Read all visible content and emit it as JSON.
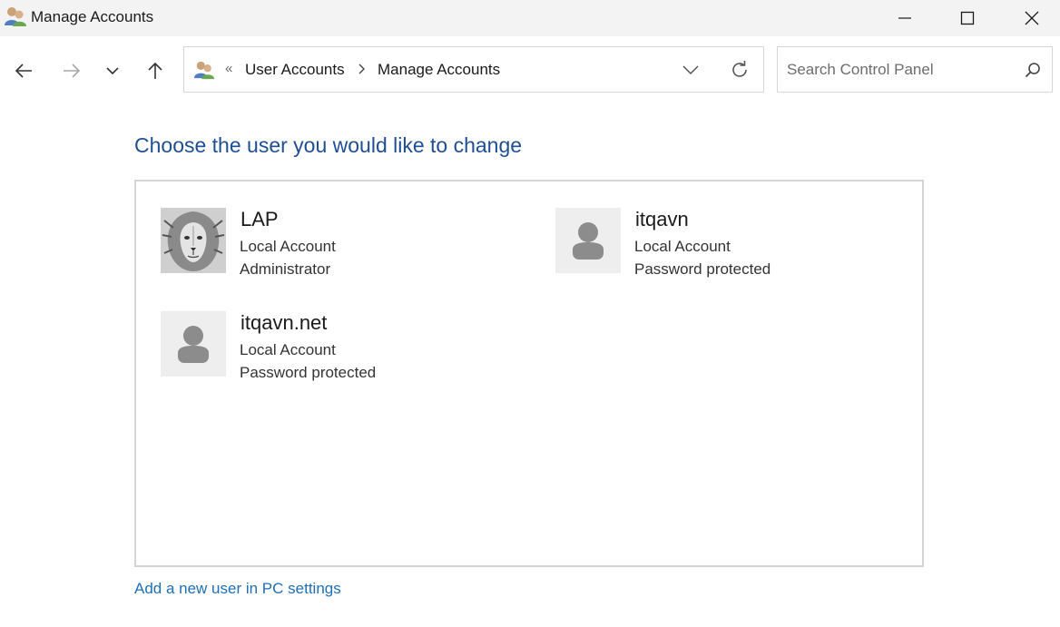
{
  "window": {
    "title": "Manage Accounts",
    "app_icon": "user-accounts-icon",
    "controls": [
      "minimize-icon",
      "maximize-icon",
      "close-icon"
    ]
  },
  "navigation": {
    "back": "back-arrow-icon",
    "forward": "forward-arrow-icon",
    "recent": "chevron-down-icon",
    "up": "up-arrow-icon"
  },
  "address_bar": {
    "location_icon": "user-accounts-icon",
    "overflow": "«",
    "breadcrumbs": [
      "User Accounts",
      "Manage Accounts"
    ],
    "dropdown": "chevron-down-icon",
    "refresh": "refresh-icon"
  },
  "search": {
    "placeholder": "Search Control Panel",
    "icon": "search-icon"
  },
  "main": {
    "heading": "Choose the user you would like to change",
    "users": [
      {
        "name": "LAP",
        "account_type": "Local Account",
        "detail": "Administrator",
        "picture": "lion-avatar"
      },
      {
        "name": "itqavn",
        "account_type": "Local Account",
        "detail": "Password protected",
        "picture": "default-user-icon"
      },
      {
        "name": "itqavn.net",
        "account_type": "Local Account",
        "detail": "Password protected",
        "picture": "default-user-icon"
      }
    ],
    "add_user_link": "Add a new user in PC settings"
  },
  "colors": {
    "heading": "#1e4f93",
    "link": "#1f6fb5",
    "titlebar": "#f3f3f3",
    "panel_border": "#d4d4d4"
  }
}
